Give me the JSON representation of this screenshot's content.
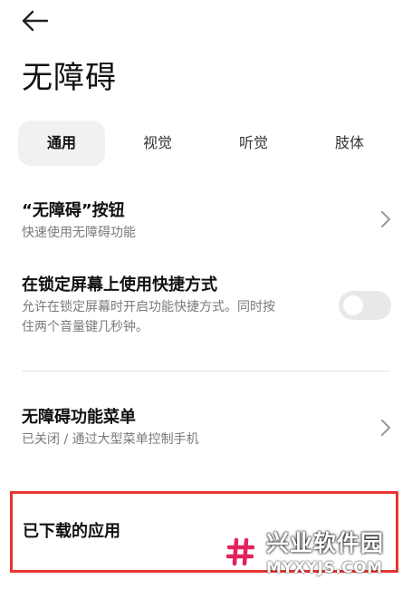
{
  "header": {
    "back_icon": "arrow-left-icon",
    "title": "无障碍"
  },
  "tabs": [
    {
      "label": "通用",
      "active": true
    },
    {
      "label": "视觉",
      "active": false
    },
    {
      "label": "听觉",
      "active": false
    },
    {
      "label": "肢体",
      "active": false
    }
  ],
  "settings": {
    "a11y_button": {
      "title": "“无障碍”按钮",
      "subtitle": "快速使用无障碍功能"
    },
    "lockscreen_shortcut": {
      "title": "在锁定屏幕上使用快捷方式",
      "subtitle_line1": "允许在锁定屏幕时开启功能快捷方式。同时按",
      "subtitle_line2": "住两个音量键几秒钟。",
      "enabled": false
    },
    "a11y_menu": {
      "title": "无障碍功能菜单",
      "subtitle": "已关闭 / 通过大型菜单控制手机"
    },
    "downloaded_apps": {
      "title": "已下载的应用"
    }
  },
  "watermark": {
    "name": "兴业软件园",
    "domain": "MYXYJS.COM"
  },
  "colors": {
    "highlight": "#e8352f",
    "toggle_off": "#e8e8e8",
    "active_tab_bg": "#f1f1f1",
    "watermark_accent": "#e0245e"
  }
}
